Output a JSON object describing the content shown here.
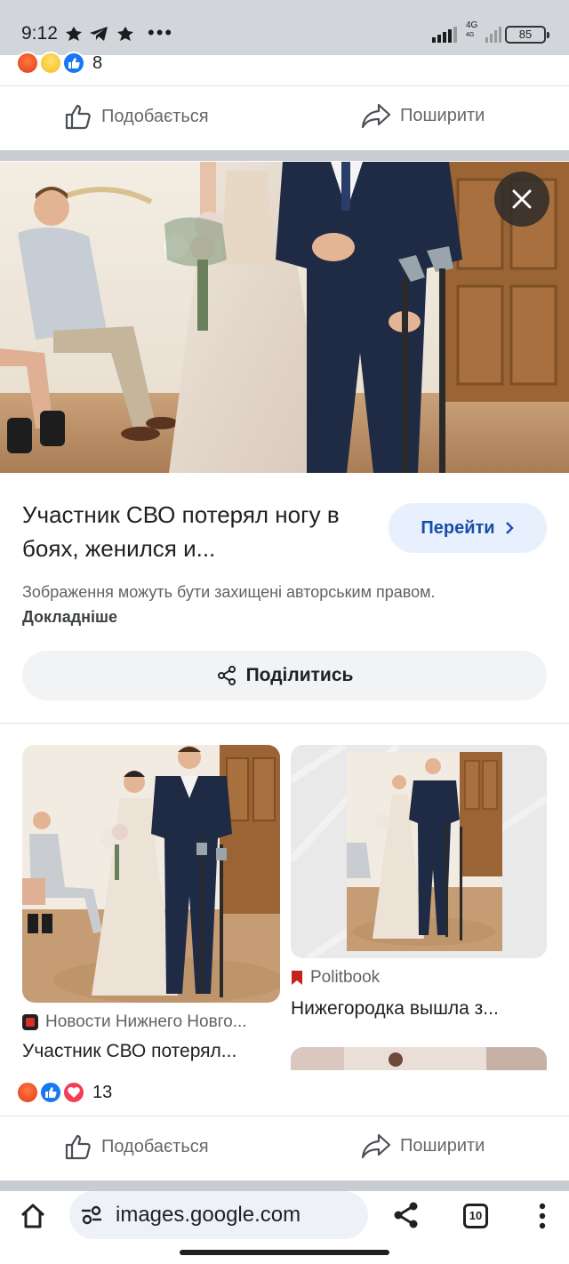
{
  "status_bar": {
    "time": "9:12",
    "more_dots": "•••",
    "network": "4G",
    "network_sub": "4G",
    "battery": "85"
  },
  "post_top": {
    "reaction_count": "8",
    "like_label": "Подобається",
    "share_label": "Поширити"
  },
  "result": {
    "title": "Участник СВО потерял ногу в боях, женился и...",
    "go_label": "Перейти",
    "copyright_text": "Зображення можуть бути захищені авторським правом.",
    "copyright_more": "Докладніше",
    "share_label": "Поділитись"
  },
  "related": [
    {
      "source": "Новости Нижнего Новго...",
      "title": "Участник СВО потерял...",
      "source_color": "#d93025"
    },
    {
      "source": "Politbook",
      "title": "Нижегородка вышла з...",
      "source_color": "#c5221f"
    }
  ],
  "post_bottom": {
    "reaction_count": "13",
    "like_label": "Подобається",
    "share_label": "Поширити"
  },
  "browser": {
    "url": "images.google.com",
    "tab_count": "10"
  },
  "icons": {
    "close": "close-icon",
    "chevron": "chevron-right-icon",
    "share": "share-icon",
    "home": "home-icon",
    "menu": "more-vert-icon"
  },
  "colors": {
    "status_bar": "#d2d6db",
    "go_button_bg": "#e8f0fe",
    "go_button_text": "#174ea6",
    "fb_like_blue": "#1877f2"
  }
}
